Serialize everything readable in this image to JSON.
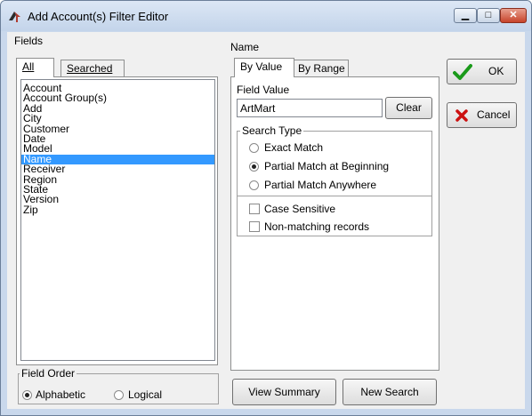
{
  "window": {
    "title": "Add Account(s) Filter Editor"
  },
  "fields": {
    "label": "Fields",
    "tabs": [
      {
        "label": "All",
        "active": true
      },
      {
        "label": "Searched",
        "active": false
      }
    ],
    "items": [
      "Account",
      "Account Group(s)",
      "Add",
      "City",
      "Customer",
      "Date",
      "Model",
      "Name",
      "Receiver",
      "Region",
      "State",
      "Version",
      "Zip"
    ],
    "selected": "Name"
  },
  "field_order": {
    "title": "Field Order",
    "options": [
      {
        "label": "Alphabetic",
        "selected": true
      },
      {
        "label": "Logical",
        "selected": false
      }
    ]
  },
  "name_panel": {
    "label": "Name",
    "tabs": [
      {
        "label": "By Value",
        "active": true
      },
      {
        "label": "By Range",
        "active": false
      }
    ],
    "field_value_label": "Field Value",
    "field_value": "ArtMart",
    "clear_label": "Clear",
    "search_type": {
      "title": "Search Type",
      "options": [
        {
          "label": "Exact Match",
          "selected": false
        },
        {
          "label": "Partial Match at Beginning",
          "selected": true
        },
        {
          "label": "Partial Match Anywhere",
          "selected": false
        }
      ]
    },
    "case_sensitive": {
      "label": "Case Sensitive",
      "checked": false
    },
    "non_matching": {
      "label": "Non-matching records",
      "checked": false
    }
  },
  "buttons": {
    "ok": "OK",
    "cancel": "Cancel",
    "view_summary": "View Summary",
    "new_search": "New Search"
  },
  "colors": {
    "selection": "#3399ff",
    "ok_check": "#1a9a1a",
    "cancel_x": "#cc1010",
    "close_button": "#c7432a"
  }
}
